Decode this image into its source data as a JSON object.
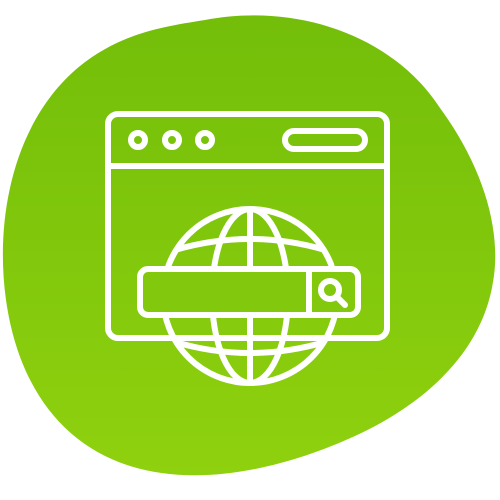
{
  "colors": {
    "background": "#ffffff",
    "blob_gradient_top": "#73be0a",
    "blob_gradient_bottom": "#8fd10e",
    "icon_stroke": "#ffffff"
  },
  "icons": {
    "main": "web-browser-globe-search-icon",
    "window_dots": [
      "window-dot-icon",
      "window-dot-icon",
      "window-dot-icon"
    ],
    "address_bar": "address-bar-icon",
    "globe": "globe-icon",
    "search_bar": "search-bar-icon",
    "magnifier": "magnifier-icon"
  }
}
